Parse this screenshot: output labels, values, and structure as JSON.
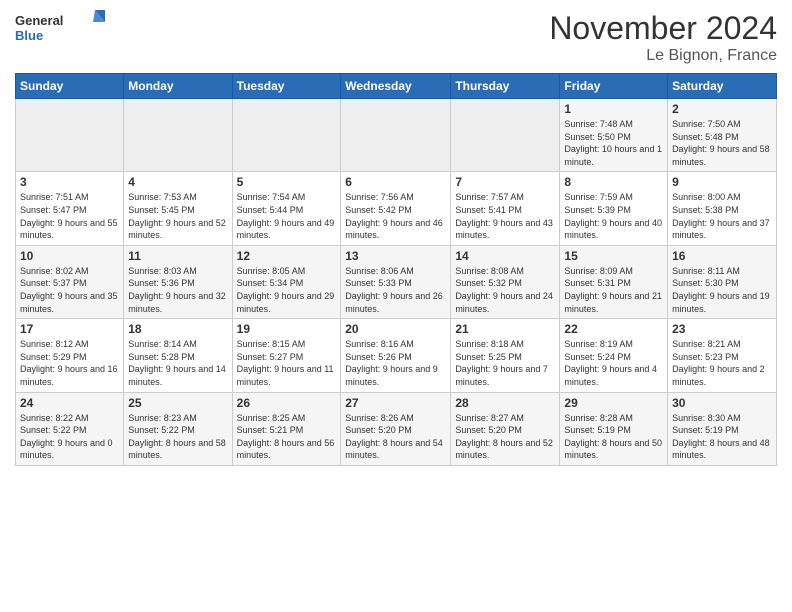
{
  "logo": {
    "text_general": "General",
    "text_blue": "Blue"
  },
  "title": "November 2024",
  "subtitle": "Le Bignon, France",
  "days_header": [
    "Sunday",
    "Monday",
    "Tuesday",
    "Wednesday",
    "Thursday",
    "Friday",
    "Saturday"
  ],
  "weeks": [
    [
      {
        "day": "",
        "info": ""
      },
      {
        "day": "",
        "info": ""
      },
      {
        "day": "",
        "info": ""
      },
      {
        "day": "",
        "info": ""
      },
      {
        "day": "",
        "info": ""
      },
      {
        "day": "1",
        "info": "Sunrise: 7:48 AM\nSunset: 5:50 PM\nDaylight: 10 hours and 1 minute."
      },
      {
        "day": "2",
        "info": "Sunrise: 7:50 AM\nSunset: 5:48 PM\nDaylight: 9 hours and 58 minutes."
      }
    ],
    [
      {
        "day": "3",
        "info": "Sunrise: 7:51 AM\nSunset: 5:47 PM\nDaylight: 9 hours and 55 minutes."
      },
      {
        "day": "4",
        "info": "Sunrise: 7:53 AM\nSunset: 5:45 PM\nDaylight: 9 hours and 52 minutes."
      },
      {
        "day": "5",
        "info": "Sunrise: 7:54 AM\nSunset: 5:44 PM\nDaylight: 9 hours and 49 minutes."
      },
      {
        "day": "6",
        "info": "Sunrise: 7:56 AM\nSunset: 5:42 PM\nDaylight: 9 hours and 46 minutes."
      },
      {
        "day": "7",
        "info": "Sunrise: 7:57 AM\nSunset: 5:41 PM\nDaylight: 9 hours and 43 minutes."
      },
      {
        "day": "8",
        "info": "Sunrise: 7:59 AM\nSunset: 5:39 PM\nDaylight: 9 hours and 40 minutes."
      },
      {
        "day": "9",
        "info": "Sunrise: 8:00 AM\nSunset: 5:38 PM\nDaylight: 9 hours and 37 minutes."
      }
    ],
    [
      {
        "day": "10",
        "info": "Sunrise: 8:02 AM\nSunset: 5:37 PM\nDaylight: 9 hours and 35 minutes."
      },
      {
        "day": "11",
        "info": "Sunrise: 8:03 AM\nSunset: 5:36 PM\nDaylight: 9 hours and 32 minutes."
      },
      {
        "day": "12",
        "info": "Sunrise: 8:05 AM\nSunset: 5:34 PM\nDaylight: 9 hours and 29 minutes."
      },
      {
        "day": "13",
        "info": "Sunrise: 8:06 AM\nSunset: 5:33 PM\nDaylight: 9 hours and 26 minutes."
      },
      {
        "day": "14",
        "info": "Sunrise: 8:08 AM\nSunset: 5:32 PM\nDaylight: 9 hours and 24 minutes."
      },
      {
        "day": "15",
        "info": "Sunrise: 8:09 AM\nSunset: 5:31 PM\nDaylight: 9 hours and 21 minutes."
      },
      {
        "day": "16",
        "info": "Sunrise: 8:11 AM\nSunset: 5:30 PM\nDaylight: 9 hours and 19 minutes."
      }
    ],
    [
      {
        "day": "17",
        "info": "Sunrise: 8:12 AM\nSunset: 5:29 PM\nDaylight: 9 hours and 16 minutes."
      },
      {
        "day": "18",
        "info": "Sunrise: 8:14 AM\nSunset: 5:28 PM\nDaylight: 9 hours and 14 minutes."
      },
      {
        "day": "19",
        "info": "Sunrise: 8:15 AM\nSunset: 5:27 PM\nDaylight: 9 hours and 11 minutes."
      },
      {
        "day": "20",
        "info": "Sunrise: 8:16 AM\nSunset: 5:26 PM\nDaylight: 9 hours and 9 minutes."
      },
      {
        "day": "21",
        "info": "Sunrise: 8:18 AM\nSunset: 5:25 PM\nDaylight: 9 hours and 7 minutes."
      },
      {
        "day": "22",
        "info": "Sunrise: 8:19 AM\nSunset: 5:24 PM\nDaylight: 9 hours and 4 minutes."
      },
      {
        "day": "23",
        "info": "Sunrise: 8:21 AM\nSunset: 5:23 PM\nDaylight: 9 hours and 2 minutes."
      }
    ],
    [
      {
        "day": "24",
        "info": "Sunrise: 8:22 AM\nSunset: 5:22 PM\nDaylight: 9 hours and 0 minutes."
      },
      {
        "day": "25",
        "info": "Sunrise: 8:23 AM\nSunset: 5:22 PM\nDaylight: 8 hours and 58 minutes."
      },
      {
        "day": "26",
        "info": "Sunrise: 8:25 AM\nSunset: 5:21 PM\nDaylight: 8 hours and 56 minutes."
      },
      {
        "day": "27",
        "info": "Sunrise: 8:26 AM\nSunset: 5:20 PM\nDaylight: 8 hours and 54 minutes."
      },
      {
        "day": "28",
        "info": "Sunrise: 8:27 AM\nSunset: 5:20 PM\nDaylight: 8 hours and 52 minutes."
      },
      {
        "day": "29",
        "info": "Sunrise: 8:28 AM\nSunset: 5:19 PM\nDaylight: 8 hours and 50 minutes."
      },
      {
        "day": "30",
        "info": "Sunrise: 8:30 AM\nSunset: 5:19 PM\nDaylight: 8 hours and 48 minutes."
      }
    ]
  ]
}
